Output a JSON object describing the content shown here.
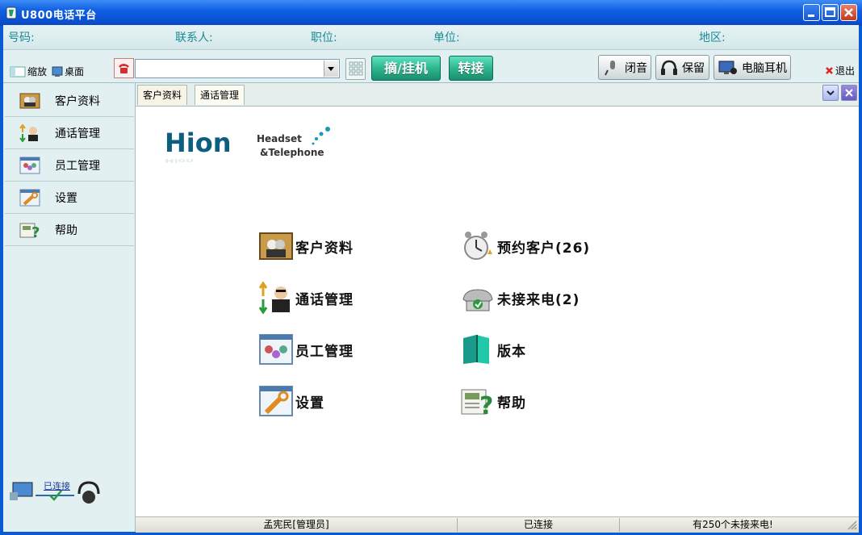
{
  "window": {
    "title": "U800电话平台"
  },
  "infobar": {
    "number_label": "号码:",
    "contact_label": "联系人:",
    "position_label": "职位:",
    "company_label": "单位:",
    "region_label": "地区:"
  },
  "toolbar": {
    "shrink_label": "缩放",
    "desktop_label": "桌面",
    "phone_value": "",
    "pickup_label": "摘/挂机",
    "transfer_label": "转接",
    "mute_label": "闭音",
    "hold_label": "保留",
    "pc_headset_label": "电脑耳机",
    "exit_label": "退出"
  },
  "sidebar": {
    "items": [
      {
        "label": "客户资料",
        "icon": "customer-icon"
      },
      {
        "label": "通话管理",
        "icon": "call-manage-icon"
      },
      {
        "label": "员工管理",
        "icon": "staff-icon"
      },
      {
        "label": "设置",
        "icon": "settings-icon"
      },
      {
        "label": "帮助",
        "icon": "help-icon"
      }
    ],
    "connection_label": "已连接"
  },
  "tabs": [
    {
      "label": "客户资料"
    },
    {
      "label": "通话管理"
    }
  ],
  "logo": {
    "brand": "Hion",
    "line1": "Headset",
    "line2": "&Telephone"
  },
  "menu": {
    "customer": "客户资料",
    "appointment": "预约客户(26)",
    "call_manage": "通话管理",
    "missed": "未接来电(2)",
    "staff": "员工管理",
    "version": "版本",
    "settings": "设置",
    "help": "帮助"
  },
  "status": {
    "user": "孟宪民[管理员]",
    "connection": "已连接",
    "missed_calls": "有250个未接来电!"
  }
}
